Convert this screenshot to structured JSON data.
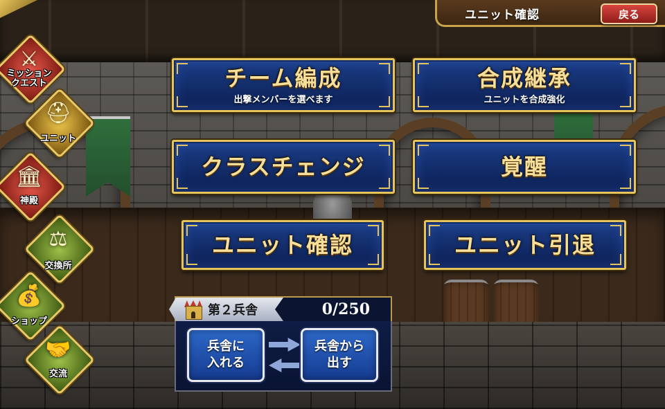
{
  "header": {
    "title": "ユニット確認",
    "back_label": "戻る"
  },
  "sidebar": {
    "items": [
      {
        "label": "ミッション\nクエスト",
        "icon": "crossed-swords-icon",
        "color": "#c0392b"
      },
      {
        "label": "ユニット",
        "icon": "helmet-icon",
        "color": "#c7a13a"
      },
      {
        "label": "神殿",
        "icon": "temple-icon",
        "color": "#c0392b"
      },
      {
        "label": "交換所",
        "icon": "scales-icon",
        "color": "#6a8a2a"
      },
      {
        "label": "ショップ",
        "icon": "money-bag-icon",
        "color": "#6a8a2a"
      },
      {
        "label": "交流",
        "icon": "handshake-icon",
        "color": "#6a8a2a"
      }
    ]
  },
  "menu": {
    "team": {
      "title": "チーム編成",
      "subtitle": "出撃メンバーを選べます"
    },
    "fusion": {
      "title": "合成継承",
      "subtitle": "ユニットを合成強化"
    },
    "class_change": {
      "title": "クラスチェンジ"
    },
    "awaken": {
      "title": "覚醒"
    },
    "unit_confirm": {
      "title": "ユニット確認"
    },
    "unit_retire": {
      "title": "ユニット引退"
    }
  },
  "barracks": {
    "name": "第２兵舎",
    "count": "0/250",
    "put_in_label": "兵舎に\n入れる",
    "take_out_label": "兵舎から\n出す"
  },
  "colors": {
    "gold": "#e5c45c",
    "button_blue": "#1b3d86",
    "back_red": "#c8332d"
  }
}
